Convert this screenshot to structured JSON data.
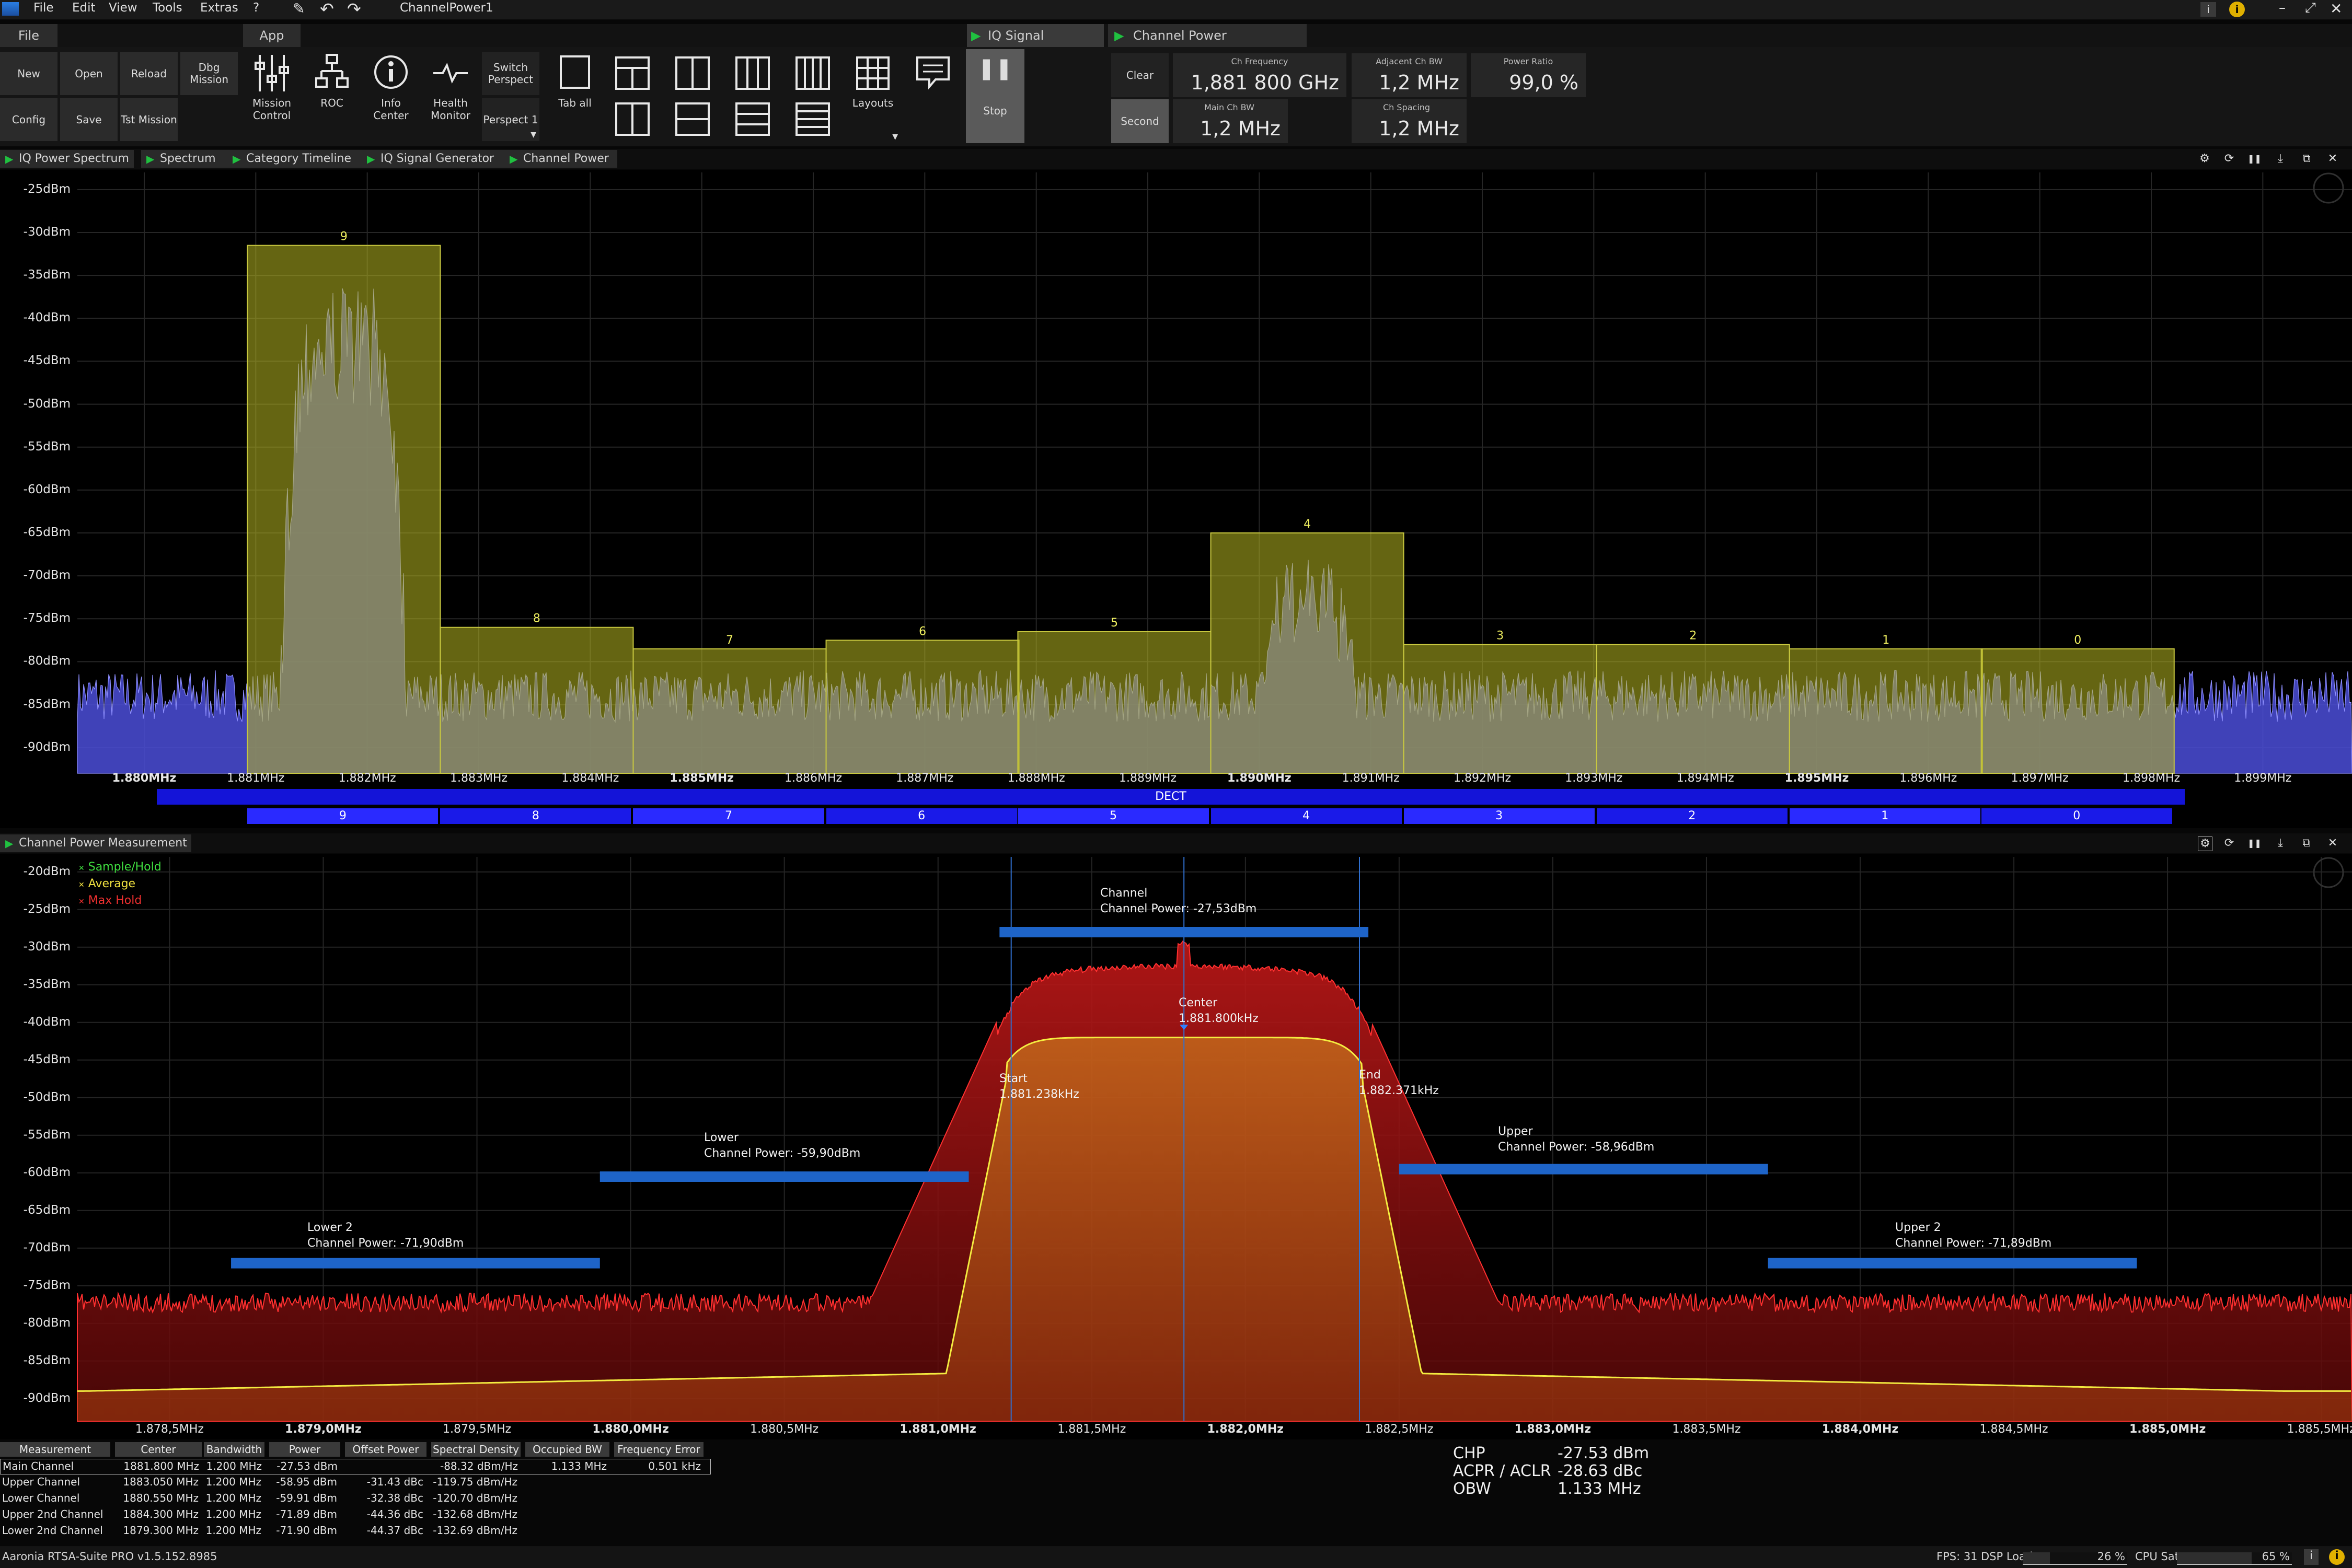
{
  "menubar": {
    "items": [
      "File",
      "Edit",
      "View",
      "Tools",
      "Extras",
      "?"
    ],
    "doc_title": "ChannelPower1"
  },
  "ribbon_tabs": [
    "File",
    "App"
  ],
  "toolbar": {
    "new": "New",
    "open": "Open",
    "reload": "Reload",
    "dbg_mission": "Dbg Mission",
    "config": "Config",
    "save": "Save",
    "tst_mission": "Tst Mission",
    "mission_control": "Mission Control",
    "roc": "ROC",
    "info_center": "Info Center",
    "health_monitor": "Health Monitor",
    "switch_perspect": "Switch Perspect",
    "perspect_1": "Perspect 1",
    "tab_all": "Tab all",
    "layouts": "Layouts",
    "stop": "Stop"
  },
  "measure_tabs": [
    "IQ Signal Generator",
    "Channel Power Measurement"
  ],
  "measure": {
    "clear": "Clear",
    "second": "Second",
    "ch_frequency_label": "Ch Frequency",
    "ch_frequency": "1,881 800 GHz",
    "adjacent_ch_bw_label": "Adjacent Ch BW",
    "adjacent_ch_bw": "1,2 MHz",
    "power_ratio_label": "Power Ratio",
    "power_ratio": "99,0 %",
    "main_ch_bw_label": "Main Ch BW",
    "main_ch_bw": "1,2 MHz",
    "ch_spacing_label": "Ch Spacing",
    "ch_spacing": "1,2 MHz"
  },
  "panel_tabs": [
    "IQ Power Spectrum",
    "Spectrum",
    "Category Timeline",
    "IQ Signal Generator",
    "Channel Power"
  ],
  "bottom_panel_tab": "Channel Power Measurement",
  "colors": {
    "accent_green": "#20c040",
    "spectrum_blue": "#5a5cff",
    "channel_yellow": "#b8b820",
    "max_hold": "#d02020",
    "average": "#f0e040",
    "marker_bar": "#1e64c8"
  },
  "upper_plot": {
    "y_ticks": [
      "-25dBm",
      "-30dBm",
      "-35dBm",
      "-40dBm",
      "-45dBm",
      "-50dBm",
      "-55dBm",
      "-60dBm",
      "-65dBm",
      "-70dBm",
      "-75dBm",
      "-80dBm",
      "-85dBm",
      "-90dBm"
    ],
    "x_ticks": [
      {
        "label": "1.880MHz",
        "bold": true
      },
      {
        "label": "1.881MHz",
        "bold": false
      },
      {
        "label": "1.882MHz",
        "bold": false
      },
      {
        "label": "1.883MHz",
        "bold": false
      },
      {
        "label": "1.884MHz",
        "bold": false
      },
      {
        "label": "1.885MHz",
        "bold": true
      },
      {
        "label": "1.886MHz",
        "bold": false
      },
      {
        "label": "1.887MHz",
        "bold": false
      },
      {
        "label": "1.888MHz",
        "bold": false
      },
      {
        "label": "1.889MHz",
        "bold": false
      },
      {
        "label": "1.890MHz",
        "bold": true
      },
      {
        "label": "1.891MHz",
        "bold": false
      },
      {
        "label": "1.892MHz",
        "bold": false
      },
      {
        "label": "1.893MHz",
        "bold": false
      },
      {
        "label": "1.894MHz",
        "bold": false
      },
      {
        "label": "1.895MHz",
        "bold": true
      },
      {
        "label": "1.896MHz",
        "bold": false
      },
      {
        "label": "1.897MHz",
        "bold": false
      },
      {
        "label": "1.898MHz",
        "bold": false
      },
      {
        "label": "1.899MHz",
        "bold": false
      }
    ],
    "band_label": "DECT",
    "channels": [
      {
        "label": "9",
        "level_dbm": -31.5
      },
      {
        "label": "8",
        "level_dbm": -76
      },
      {
        "label": "7",
        "level_dbm": -78.5
      },
      {
        "label": "6",
        "level_dbm": -77.5
      },
      {
        "label": "5",
        "level_dbm": -76.5
      },
      {
        "label": "4",
        "level_dbm": -65
      },
      {
        "label": "3",
        "level_dbm": -78
      },
      {
        "label": "2",
        "level_dbm": -78
      },
      {
        "label": "1",
        "level_dbm": -78.5
      },
      {
        "label": "0",
        "level_dbm": -78.5
      }
    ]
  },
  "lower_plot": {
    "legend": [
      "Sample/Hold",
      "Average",
      "Max Hold"
    ],
    "y_ticks": [
      "-20dBm",
      "-25dBm",
      "-30dBm",
      "-35dBm",
      "-40dBm",
      "-45dBm",
      "-50dBm",
      "-55dBm",
      "-60dBm",
      "-65dBm",
      "-70dBm",
      "-75dBm",
      "-80dBm",
      "-85dBm",
      "-90dBm"
    ],
    "x_ticks": [
      {
        "label": "1.878,5MHz",
        "bold": false
      },
      {
        "label": "1.879,0MHz",
        "bold": true
      },
      {
        "label": "1.879,5MHz",
        "bold": false
      },
      {
        "label": "1.880,0MHz",
        "bold": true
      },
      {
        "label": "1.880,5MHz",
        "bold": false
      },
      {
        "label": "1.881,0MHz",
        "bold": true
      },
      {
        "label": "1.881,5MHz",
        "bold": false
      },
      {
        "label": "1.882,0MHz",
        "bold": true
      },
      {
        "label": "1.882,5MHz",
        "bold": false
      },
      {
        "label": "1.883,0MHz",
        "bold": true
      },
      {
        "label": "1.883,5MHz",
        "bold": false
      },
      {
        "label": "1.884,0MHz",
        "bold": true
      },
      {
        "label": "1.884,5MHz",
        "bold": false
      },
      {
        "label": "1.885,0MHz",
        "bold": true
      },
      {
        "label": "1.885,5MHz",
        "bold": false
      }
    ],
    "annotations": {
      "channel_title": "Channel",
      "channel_power": "Channel Power: -27,53dBm",
      "center_title": "Center",
      "center_freq": "1.881.800kHz",
      "start_title": "Start",
      "start_freq": "1.881.238kHz",
      "end_title": "End",
      "end_freq": "1.882.371kHz",
      "lower_title": "Lower",
      "lower_power": "Channel Power: -59,90dBm",
      "upper_title": "Upper",
      "upper_power": "Channel Power: -58,96dBm",
      "lower2_title": "Lower 2",
      "lower2_power": "Channel Power: -71,90dBm",
      "upper2_title": "Upper 2",
      "upper2_power": "Channel Power: -71,89dBm"
    }
  },
  "table": {
    "headers": [
      "Measurement",
      "Center",
      "Bandwidth",
      "Power",
      "Offset Power",
      "Spectral Density",
      "Occupied BW",
      "Frequency Error"
    ],
    "rows": [
      [
        "Main Channel",
        "1881.800 MHz",
        "1.200 MHz",
        "-27.53 dBm",
        "",
        "-88.32 dBm/Hz",
        "1.133 MHz",
        "0.501 kHz"
      ],
      [
        "Upper Channel",
        "1883.050 MHz",
        "1.200 MHz",
        "-58.95 dBm",
        "-31.43 dBc",
        "-119.75 dBm/Hz",
        "",
        ""
      ],
      [
        "Lower Channel",
        "1880.550 MHz",
        "1.200 MHz",
        "-59.91 dBm",
        "-32.38 dBc",
        "-120.70 dBm/Hz",
        "",
        ""
      ],
      [
        "Upper 2nd Channel",
        "1884.300 MHz",
        "1.200 MHz",
        "-71.89 dBm",
        "-44.36 dBc",
        "-132.68 dBm/Hz",
        "",
        ""
      ],
      [
        "Lower 2nd Channel",
        "1879.300 MHz",
        "1.200 MHz",
        "-71.90 dBm",
        "-44.37 dBc",
        "-132.69 dBm/Hz",
        "",
        ""
      ]
    ]
  },
  "summary": {
    "chp_label": "CHP",
    "chp": "-27.53 dBm",
    "acpr_label": "ACPR / ACLR",
    "acpr": "-28.63 dBc",
    "obw_label": "OBW",
    "obw": "1.133 MHz"
  },
  "status": {
    "version": "Aaronia RTSA-Suite PRO v1.5.152.8985",
    "fps": "FPS: 31",
    "dsp_label": "DSP Load:",
    "dsp": "26 %",
    "dsp_fraction": 0.26,
    "cpu_label": "CPU Sat:",
    "cpu": "65 %",
    "cpu_fraction": 0.65
  },
  "chart_data": [
    {
      "type": "bar",
      "title": "",
      "categories": [
        "9",
        "8",
        "7",
        "6",
        "5",
        "4",
        "3",
        "2",
        "1",
        "0"
      ],
      "values": [
        -31.5,
        -76,
        -78.5,
        -77.5,
        -76.5,
        -65,
        -78,
        -78,
        -78.5,
        -78.5
      ],
      "ylim": [
        -93,
        -23
      ],
      "y_ticks": [
        "-25dBm",
        "-30dBm",
        "-35dBm",
        "-40dBm",
        "-45dBm",
        "-50dBm",
        "-55dBm",
        "-60dBm",
        "-65dBm",
        "-70dBm",
        "-75dBm",
        "-80dBm",
        "-85dBm",
        "-90dBm"
      ],
      "xlim_mhz": [
        1.8794,
        1.8998
      ],
      "channel_centers_mhz": [
        1.88179,
        1.88352,
        1.88525,
        1.88698,
        1.8887,
        1.89043,
        1.89216,
        1.89389,
        1.89562,
        1.89734
      ],
      "band": "DECT",
      "grid": true
    },
    {
      "type": "line",
      "title": "",
      "series": [
        {
          "name": "Max Hold",
          "x_mhz": [
            1.8782,
            1.8808,
            1.881,
            1.8812,
            1.8815,
            1.8818,
            1.8821,
            1.8824,
            1.8826,
            1.8828,
            1.8855
          ],
          "y_dbm": [
            -76,
            -75,
            -61,
            -37,
            -33,
            -30,
            -33,
            -37,
            -61,
            -75,
            -76
          ]
        },
        {
          "name": "Average",
          "x_mhz": [
            1.8782,
            1.8808,
            1.881,
            1.8812,
            1.8815,
            1.8818,
            1.8821,
            1.8824,
            1.8826,
            1.8828,
            1.8855
          ],
          "y_dbm": [
            -88.5,
            -86.5,
            -82,
            -47,
            -42.5,
            -42,
            -42.5,
            -47,
            -82,
            -86.5,
            -88.5
          ]
        }
      ],
      "ylim": [
        -93,
        -18
      ],
      "xlim_mhz": [
        1.8782,
        1.8856
      ],
      "channel_markers": [
        {
          "name": "Lower 2",
          "from_mhz": 1.8787,
          "to_mhz": 1.8799,
          "dbm": -72
        },
        {
          "name": "Lower",
          "from_mhz": 1.8799,
          "to_mhz": 1.8811,
          "dbm": -60.5
        },
        {
          "name": "Channel",
          "from_mhz": 1.8812,
          "to_mhz": 1.8824,
          "dbm": -28
        },
        {
          "name": "Upper",
          "from_mhz": 1.8825,
          "to_mhz": 1.8837,
          "dbm": -59.5
        },
        {
          "name": "Upper 2",
          "from_mhz": 1.8837,
          "to_mhz": 1.8849,
          "dbm": -72
        }
      ],
      "grid": true
    }
  ]
}
